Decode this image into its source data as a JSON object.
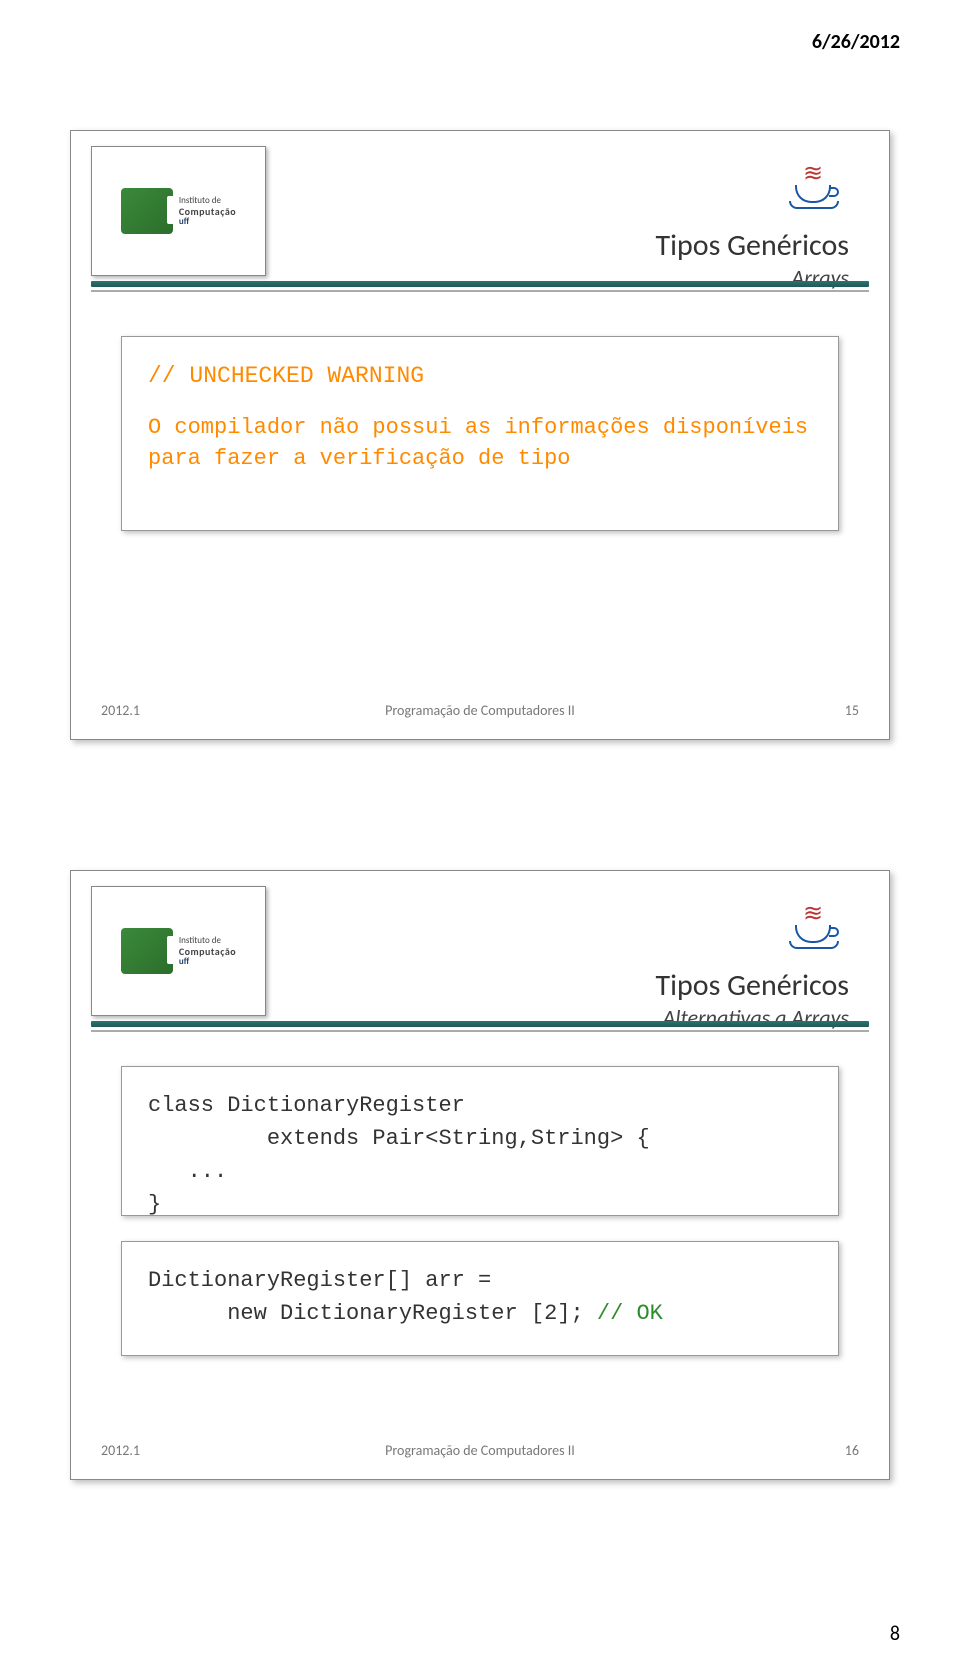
{
  "page": {
    "header_date": "6/26/2012",
    "page_number": "8"
  },
  "logo": {
    "line1": "Instituto de",
    "line2": "Computação",
    "org": "uff"
  },
  "slide1": {
    "title": "Tipos Genéricos",
    "subtitle": "Arrays",
    "code_comment": "// UNCHECKED WARNING",
    "body": "O compilador não possui as informações disponíveis para fazer a verificação de tipo",
    "footer_left": "2012.1",
    "footer_center": "Programação de Computadores II",
    "footer_right": "15"
  },
  "slide2": {
    "title": "Tipos Genéricos",
    "subtitle": "Alternativas a Arrays",
    "code_block_a_l1": "class DictionaryRegister",
    "code_block_a_l2": "         extends Pair<String,String> {",
    "code_block_a_l3": "   ...",
    "code_block_a_l4": "}",
    "code_block_b_l1": "DictionaryRegister[] arr =",
    "code_block_b_l2_a": "      new DictionaryRegister [2]; ",
    "code_block_b_l2_b": "// OK",
    "footer_left": "2012.1",
    "footer_center": "Programação de Computadores II",
    "footer_right": "16"
  }
}
